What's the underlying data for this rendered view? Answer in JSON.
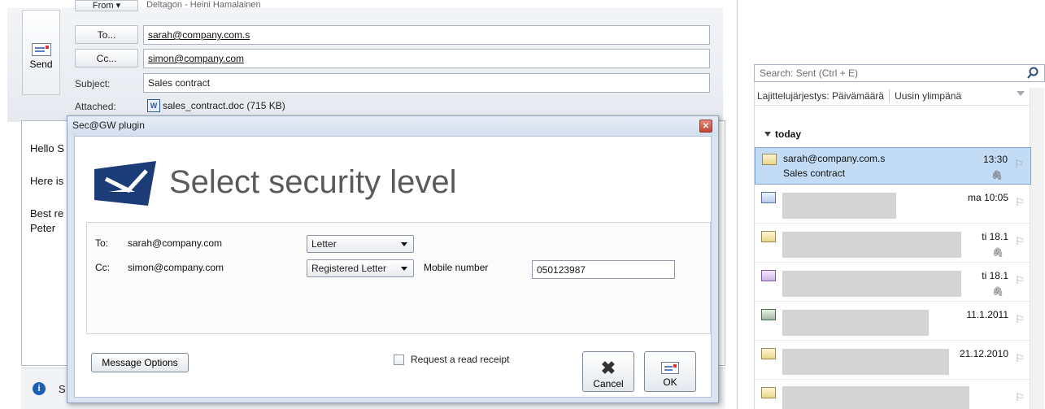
{
  "compose": {
    "send_label": "Send",
    "from_label": "From ▾",
    "from_value": "Deltagon - Heini Hamalainen",
    "to_button": "To...",
    "to_value": "sarah@company.com.s",
    "cc_button": "Cc...",
    "cc_value": "simon@company.com",
    "subject_label": "Subject:",
    "subject_value": "Sales contract",
    "attached_label": "Attached:",
    "attached_value": "sales_contract.doc (715 KB)",
    "body_lines": [
      "Hello S",
      "Here is",
      "Best re",
      "Peter"
    ],
    "status_text": "S"
  },
  "dialog": {
    "title": "Sec@GW plugin",
    "heading": "Select security level",
    "to_label": "To:",
    "to_address": "sarah@company.com",
    "to_level": "Letter",
    "cc_label": "Cc:",
    "cc_address": "simon@company.com",
    "cc_level": "Registered Letter",
    "mobile_label": "Mobile number",
    "mobile_value": "050123987",
    "options_button": "Message Options",
    "receipt_label": "Request a read receipt",
    "cancel_label": "Cancel",
    "ok_label": "OK"
  },
  "sent_list": {
    "search_placeholder": "Search: Sent (Ctrl + E)",
    "sort_label": "Lajittelujärjestys: Päivämäärä",
    "sort_order": "Uusin ylimpänä",
    "group_today": "today",
    "items": [
      {
        "from": "sarah@company.com.s",
        "subject": "Sales contract",
        "time": "13:30",
        "selected": true
      },
      {
        "from": "",
        "subject": "",
        "time": "ma 10:05"
      },
      {
        "from": "",
        "subject": "",
        "time": "ti 18.1"
      },
      {
        "from": "",
        "subject": "",
        "time": "ti 18.1"
      },
      {
        "from": "",
        "subject": "",
        "time": "11.1.2011"
      },
      {
        "from": "",
        "subject": "",
        "time": "21.12.2010"
      },
      {
        "from": "",
        "subject": "",
        "time": ""
      }
    ]
  }
}
